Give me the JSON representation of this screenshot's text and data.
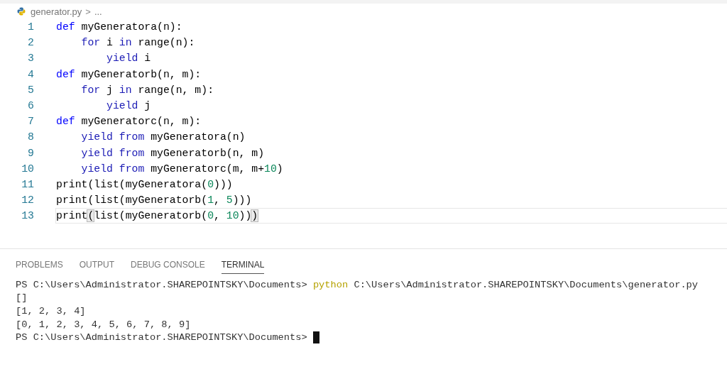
{
  "breadcrumb": {
    "file": "generator.py",
    "separator": ">",
    "more": "..."
  },
  "editor": {
    "lines": [
      {
        "number": "1",
        "current": false,
        "tokens": [
          {
            "text": "def",
            "kind": "keyword"
          },
          {
            "text": " myGeneratora(n):",
            "kind": "plain"
          }
        ]
      },
      {
        "number": "2",
        "current": false,
        "tokens": [
          {
            "text": "    for",
            "kind": "control"
          },
          {
            "text": " i ",
            "kind": "plain"
          },
          {
            "text": "in",
            "kind": "control"
          },
          {
            "text": " range(n):",
            "kind": "plain"
          }
        ]
      },
      {
        "number": "3",
        "current": false,
        "tokens": [
          {
            "text": "        yield",
            "kind": "control"
          },
          {
            "text": " i",
            "kind": "plain"
          }
        ]
      },
      {
        "number": "4",
        "current": false,
        "tokens": [
          {
            "text": "def",
            "kind": "keyword"
          },
          {
            "text": " myGeneratorb(n, m):",
            "kind": "plain"
          }
        ]
      },
      {
        "number": "5",
        "current": false,
        "tokens": [
          {
            "text": "    for",
            "kind": "control"
          },
          {
            "text": " j ",
            "kind": "plain"
          },
          {
            "text": "in",
            "kind": "control"
          },
          {
            "text": " range(n, m):",
            "kind": "plain"
          }
        ]
      },
      {
        "number": "6",
        "current": false,
        "tokens": [
          {
            "text": "        yield",
            "kind": "control"
          },
          {
            "text": " j",
            "kind": "plain"
          }
        ]
      },
      {
        "number": "7",
        "current": false,
        "tokens": [
          {
            "text": "def",
            "kind": "keyword"
          },
          {
            "text": " myGeneratorc(n, m):",
            "kind": "plain"
          }
        ]
      },
      {
        "number": "8",
        "current": false,
        "tokens": [
          {
            "text": "    yield from",
            "kind": "control"
          },
          {
            "text": " myGeneratora(n)",
            "kind": "plain"
          }
        ]
      },
      {
        "number": "9",
        "current": false,
        "tokens": [
          {
            "text": "    yield from",
            "kind": "control"
          },
          {
            "text": " myGeneratorb(n, m)",
            "kind": "plain"
          }
        ]
      },
      {
        "number": "10",
        "current": false,
        "tokens": [
          {
            "text": "    yield from",
            "kind": "control"
          },
          {
            "text": " myGeneratorc(m, m+",
            "kind": "plain"
          },
          {
            "text": "10",
            "kind": "number"
          },
          {
            "text": ")",
            "kind": "plain"
          }
        ]
      },
      {
        "number": "11",
        "current": false,
        "tokens": [
          {
            "text": "print(list(myGeneratora(",
            "kind": "plain"
          },
          {
            "text": "0",
            "kind": "number"
          },
          {
            "text": ")))",
            "kind": "plain"
          }
        ]
      },
      {
        "number": "12",
        "current": false,
        "tokens": [
          {
            "text": "print(list(myGeneratorb(",
            "kind": "plain"
          },
          {
            "text": "1",
            "kind": "number"
          },
          {
            "text": ", ",
            "kind": "plain"
          },
          {
            "text": "5",
            "kind": "number"
          },
          {
            "text": ")))",
            "kind": "plain"
          }
        ]
      },
      {
        "number": "13",
        "current": true,
        "tokens": [
          {
            "text": "print",
            "kind": "plain"
          },
          {
            "text": "(",
            "kind": "bracket-match"
          },
          {
            "text": "list(myGeneratorb(",
            "kind": "plain"
          },
          {
            "text": "0",
            "kind": "number"
          },
          {
            "text": ", ",
            "kind": "plain"
          },
          {
            "text": "10",
            "kind": "number"
          },
          {
            "text": "))",
            "kind": "plain"
          },
          {
            "text": ")",
            "kind": "bracket-match"
          }
        ]
      }
    ]
  },
  "panel": {
    "tabs": [
      {
        "label": "PROBLEMS",
        "selected": false
      },
      {
        "label": "OUTPUT",
        "selected": false
      },
      {
        "label": "DEBUG CONSOLE",
        "selected": false
      },
      {
        "label": "TERMINAL",
        "selected": true
      }
    ],
    "terminal": {
      "lines": [
        [
          {
            "text": "PS C:\\Users\\Administrator.SHAREPOINTSKY\\Documents> ",
            "kind": "plain"
          },
          {
            "text": "python",
            "kind": "command"
          },
          {
            "text": " C:\\Users\\Administrator.SHAREPOINTSKY\\Documents\\generator.py",
            "kind": "plain"
          }
        ],
        [
          {
            "text": "[]",
            "kind": "plain"
          }
        ],
        [
          {
            "text": "[1, 2, 3, 4]",
            "kind": "plain"
          }
        ],
        [
          {
            "text": "[0, 1, 2, 3, 4, 5, 6, 7, 8, 9]",
            "kind": "plain"
          }
        ],
        [
          {
            "text": "PS C:\\Users\\Administrator.SHAREPOINTSKY\\Documents> ",
            "kind": "plain"
          }
        ]
      ],
      "cursor": true
    }
  }
}
